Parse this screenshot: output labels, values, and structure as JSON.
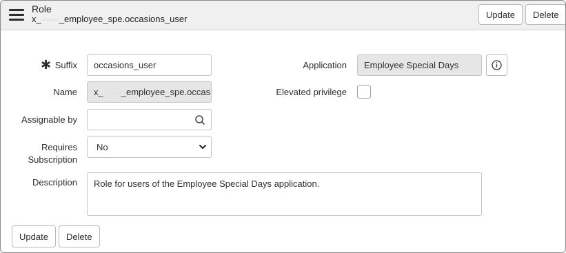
{
  "header": {
    "title": "Role",
    "subtitle_prefix": "x_",
    "subtitle_suffix": "_employee_spe.occasions_user",
    "update_label": "Update",
    "delete_label": "Delete"
  },
  "form": {
    "suffix": {
      "label": "Suffix",
      "value": "occasions_user"
    },
    "name": {
      "label": "Name",
      "value_prefix": "x_",
      "value_suffix": "_employee_spe.occasio"
    },
    "assignable_by": {
      "label": "Assignable by",
      "value": ""
    },
    "requires_subscription": {
      "label_line1": "Requires",
      "label_line2": "Subscription",
      "value": "No"
    },
    "description": {
      "label": "Description",
      "value": "Role for users of the Employee Special Days application."
    },
    "application": {
      "label": "Application",
      "value": "Employee Special Days"
    },
    "elevated_privilege": {
      "label": "Elevated privilege",
      "checked": false
    }
  },
  "footer": {
    "update_label": "Update",
    "delete_label": "Delete"
  },
  "icons": {
    "menu": "hamburger-menu-icon",
    "mandatory": "asterisk-icon",
    "search": "search-icon",
    "info": "info-icon",
    "dropdown": "chevron-down-icon"
  }
}
